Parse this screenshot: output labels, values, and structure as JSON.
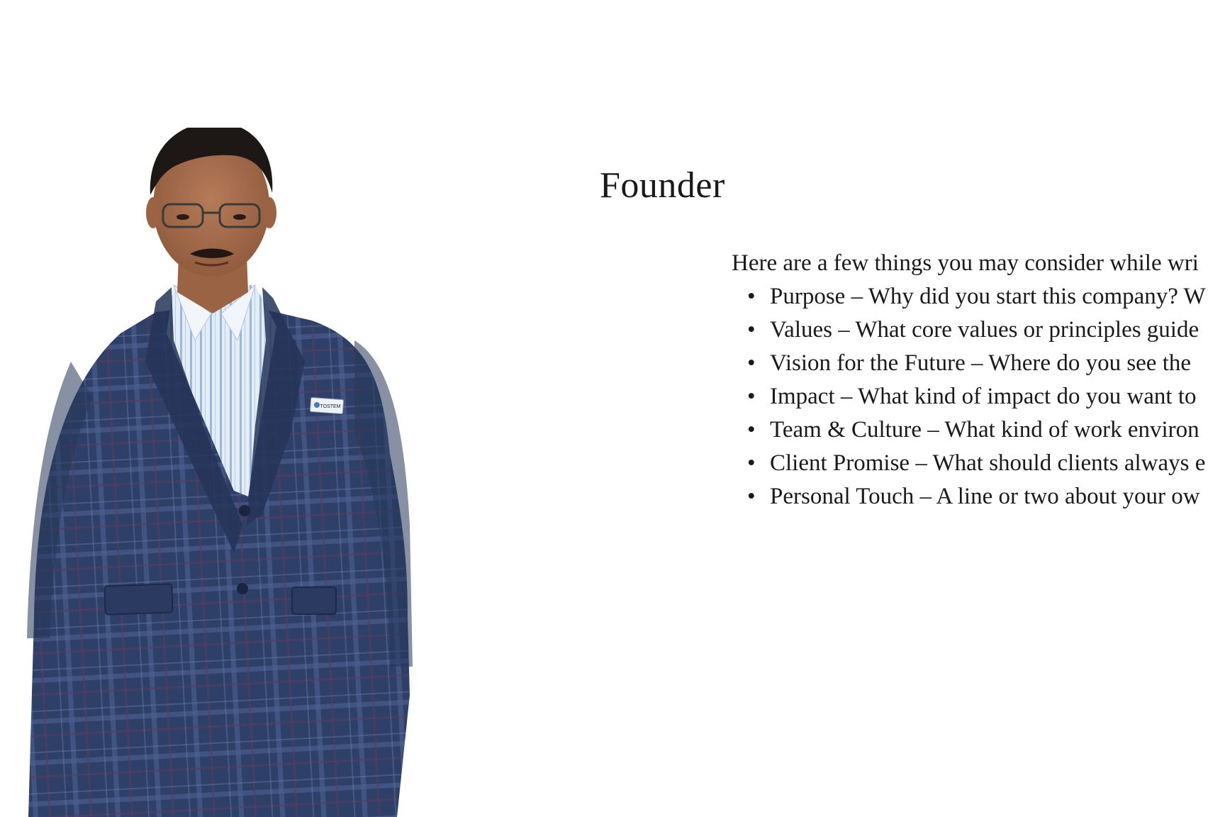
{
  "page": {
    "title": "Founder",
    "intro": "Here are a few things you may consider while wri",
    "points": [
      "Purpose – Why did you start this company? W",
      "Values – What core values or principles guide",
      "Vision for the Future – Where do you see the",
      "Impact – What kind of impact do you want to",
      "Team & Culture – What kind of work environ",
      "Client Promise – What should clients always e",
      "Personal Touch – A line or two about your ow"
    ],
    "bullet_glyph": "•"
  },
  "photo": {
    "badge_text": "TOSTEM"
  },
  "colors": {
    "background": "#ffffff",
    "text": "#1a1a1a",
    "jacket": "#2e3f63",
    "shirt": "#dce8f5"
  }
}
